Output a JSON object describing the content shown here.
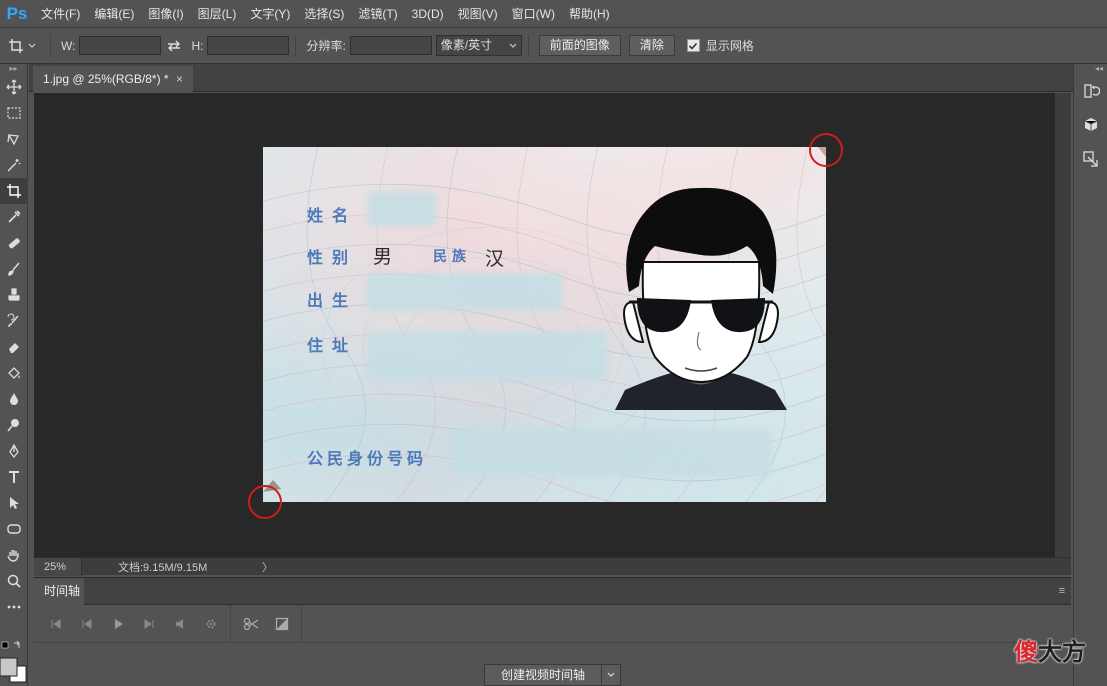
{
  "app": {
    "logo": "Ps",
    "accent": "#31a8ff"
  },
  "menu": [
    "文件(F)",
    "编辑(E)",
    "图像(I)",
    "图层(L)",
    "文字(Y)",
    "选择(S)",
    "滤镜(T)",
    "3D(D)",
    "视图(V)",
    "窗口(W)",
    "帮助(H)"
  ],
  "options": {
    "tool_icon": "crop-icon",
    "width_label": "W:",
    "width_value": "",
    "swap_icon": "swap-arrows-icon",
    "height_label": "H:",
    "height_value": "",
    "resolution_label": "分辨率:",
    "resolution_value": "",
    "unit_select": "像素/英寸",
    "front_image_button": "前面的图像",
    "clear_button": "清除",
    "show_grid_label": "显示网格",
    "show_grid_checked": true
  },
  "document": {
    "tab_title": "1.jpg @ 25%(RGB/8*) *",
    "close": "×"
  },
  "status": {
    "zoom": "25%",
    "doc_info": "文档:9.15M/9.15M",
    "arrow": "〉"
  },
  "timeline": {
    "tab": "时间轴",
    "menu_icon": "≡",
    "create_button": "创建视频时间轴"
  },
  "card": {
    "name_label": "姓名",
    "gender_label": "性别",
    "gender_value": "男",
    "ethnicity_label": "民族",
    "ethnicity_value": "汉",
    "birth_label": "出生",
    "address_label": "住址",
    "id_label": "公民身份号码",
    "label_color": "#4d79b8",
    "marker_color": "#d21c1c"
  },
  "watermark": {
    "part_a": "傻",
    "part_b": "大方",
    "color_a": "#d9282c"
  }
}
